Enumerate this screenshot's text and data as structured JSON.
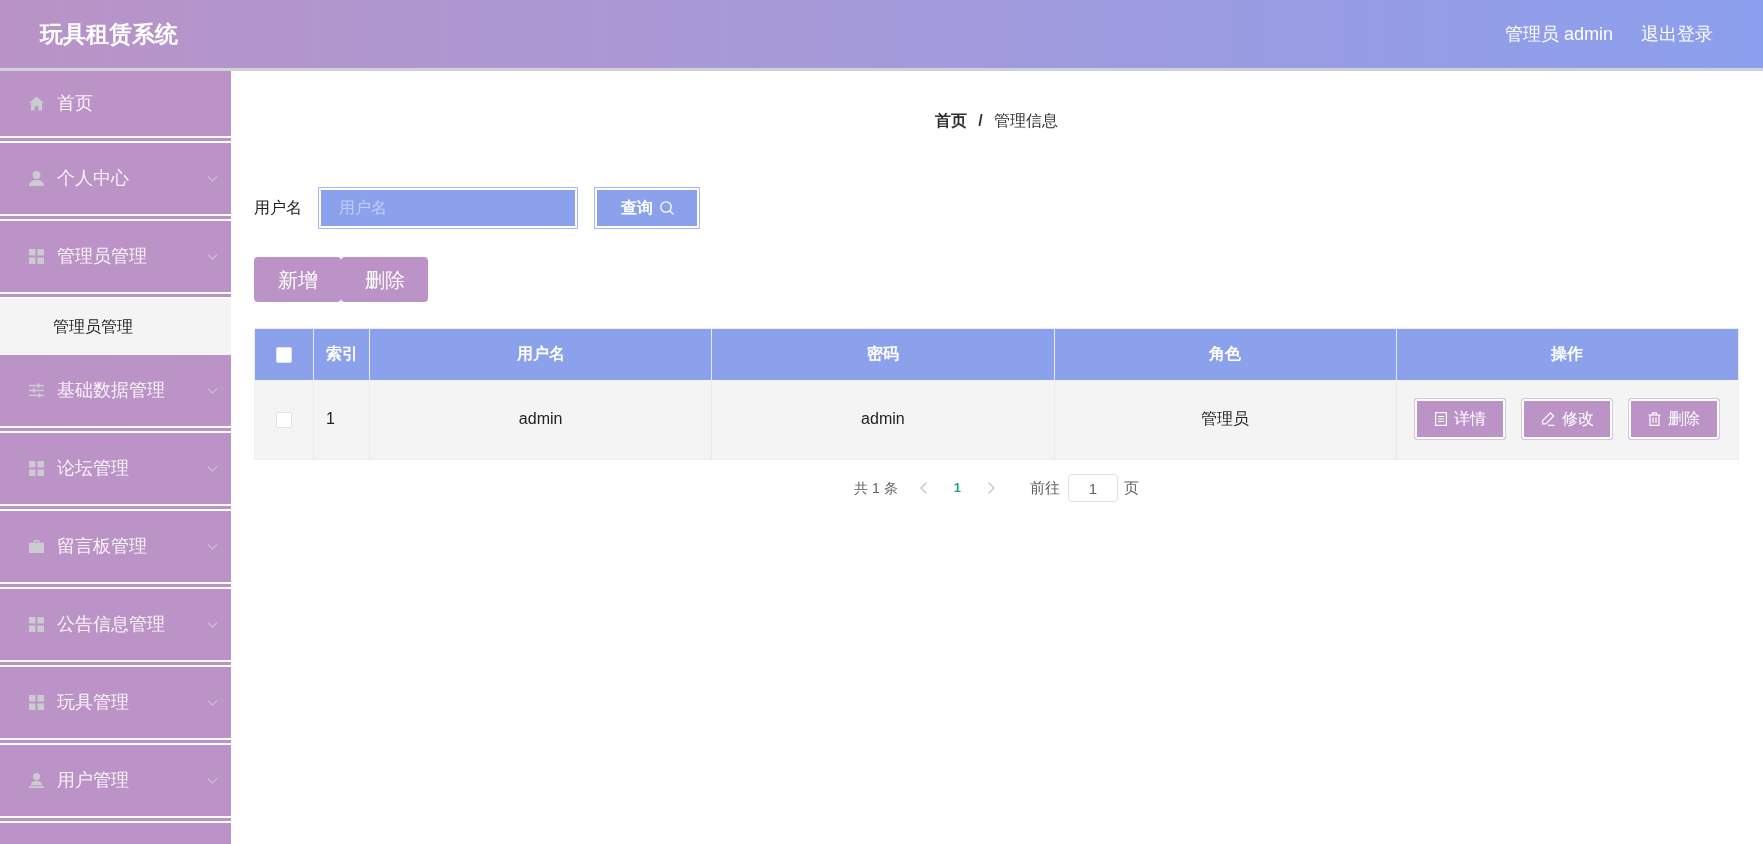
{
  "header": {
    "title": "玩具租赁系统",
    "user": "管理员 admin",
    "logout": "退出登录"
  },
  "sidebar": {
    "items": [
      {
        "label": "首页",
        "kind": "link"
      },
      {
        "label": "个人中心",
        "kind": "submenu"
      },
      {
        "label": "管理员管理",
        "kind": "submenu",
        "children": [
          {
            "label": "管理员管理"
          }
        ]
      },
      {
        "label": "基础数据管理",
        "kind": "submenu"
      },
      {
        "label": "论坛管理",
        "kind": "submenu"
      },
      {
        "label": "留言板管理",
        "kind": "submenu"
      },
      {
        "label": "公告信息管理",
        "kind": "submenu"
      },
      {
        "label": "玩具管理",
        "kind": "submenu"
      },
      {
        "label": "用户管理",
        "kind": "submenu"
      }
    ]
  },
  "breadcrumb": {
    "items": [
      "首页",
      "管理信息"
    ],
    "separator": "/"
  },
  "search": {
    "label": "用户名",
    "placeholder": "用户名",
    "button": "查询"
  },
  "toolbar": {
    "buttons": [
      "新增",
      "删除"
    ]
  },
  "table": {
    "header_checkbox": {
      "checked": false
    },
    "columns": [
      "索引",
      "用户名",
      "密码",
      "角色",
      "操作"
    ],
    "rows": [
      {
        "checked": false,
        "cells": [
          "1",
          "admin",
          "admin",
          "管理员"
        ],
        "actions": [
          "详情",
          "修改",
          "删除"
        ]
      }
    ]
  },
  "pagination": {
    "total": "共 1 条",
    "pages": [
      {
        "label": "1",
        "selected": true
      }
    ],
    "goto_label": "前往",
    "goto_value": "1",
    "goto_suffix": "页"
  }
}
